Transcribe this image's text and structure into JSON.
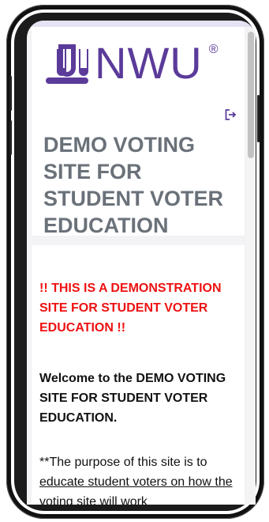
{
  "brand": {
    "name": "NWU",
    "registered": "®",
    "color": "#5b3b9a"
  },
  "icons": {
    "logout": "logout-icon",
    "logo": "nwu-logo-icon"
  },
  "header": {
    "title": "DEMO VOTING SITE FOR STUDENT VOTER EDUCATION"
  },
  "content": {
    "warning": "!! THIS IS A DEMONSTRATION SITE FOR STUDENT VOTER EDUCATION !!",
    "welcome": "Welcome to the DEMO VOTING SITE FOR STUDENT VOTER EDUCATION.",
    "purpose_prefix": "**The purpose of this site is to ",
    "purpose_link": "educate student voters on how the voting site will work"
  },
  "colors": {
    "title": "#6a7179",
    "warning": "#ee1111"
  }
}
